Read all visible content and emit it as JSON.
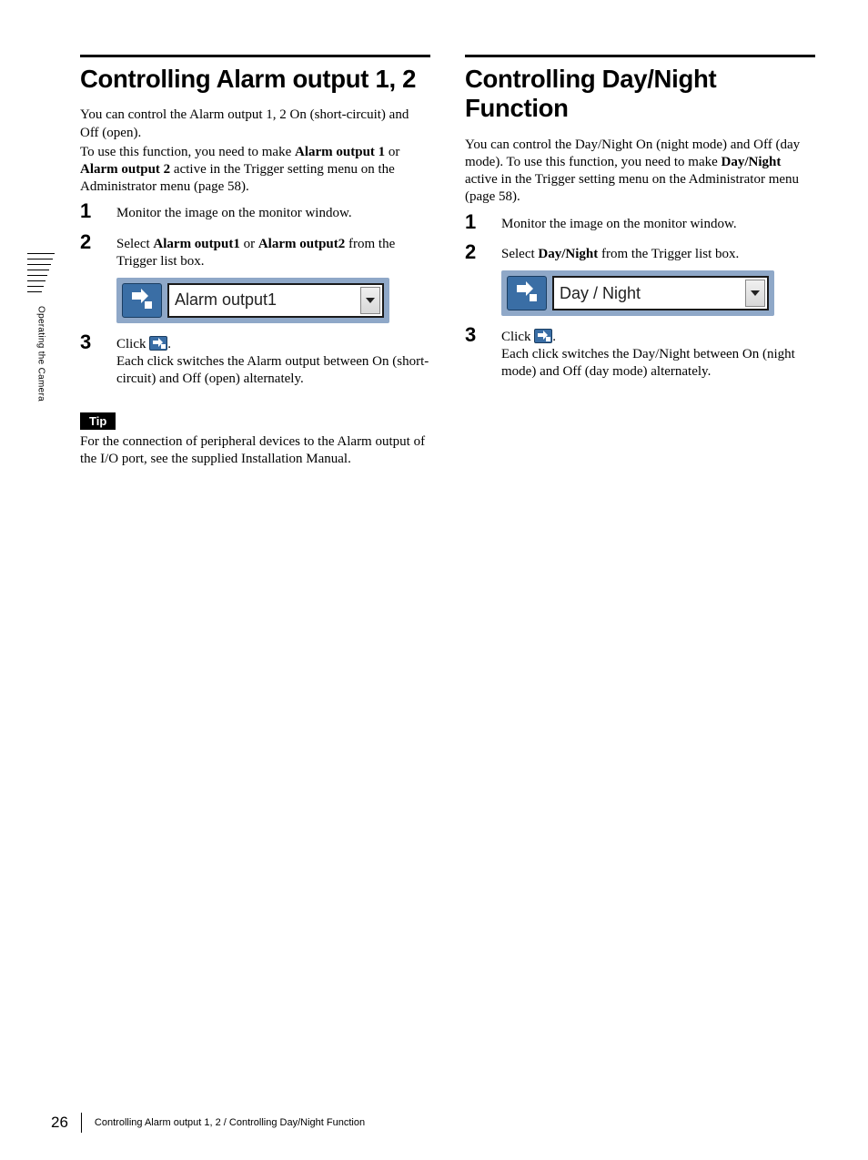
{
  "sidebar": {
    "section_label": "Operating the Camera"
  },
  "left": {
    "title": "Controlling Alarm output 1, 2",
    "intro_parts": [
      "You can control the Alarm output 1, 2 On (short-circuit) and Off (open).",
      "To use this function, you need to make ",
      "Alarm output 1",
      " or ",
      "Alarm output 2",
      " active in the Trigger setting menu on the Administrator menu (page 58)."
    ],
    "steps": {
      "s1": "Monitor the image on the monitor window.",
      "s2_pre": "Select ",
      "s2_b1": "Alarm output1",
      "s2_mid": " or ",
      "s2_b2": "Alarm output2",
      "s2_post": " from the Trigger list box.",
      "dropdown_value": "Alarm output1",
      "s3_pre": "Click ",
      "s3_post": ".",
      "s3_body": "Each click switches the Alarm output between On (short-circuit) and Off (open) alternately."
    },
    "tip_label": "Tip",
    "tip_body": "For the connection of peripheral devices to the Alarm output of the I/O port, see the supplied Installation Manual."
  },
  "right": {
    "title": "Controlling Day/Night Function",
    "intro_parts": [
      "You can control the Day/Night On (night mode) and Off (day mode). To use this function, you need to make ",
      "Day/Night",
      " active in the Trigger setting menu on the Administrator menu (page 58)."
    ],
    "steps": {
      "s1": "Monitor the image on the monitor window.",
      "s2_pre": "Select ",
      "s2_b1": "Day/Night",
      "s2_post": " from the Trigger list box.",
      "dropdown_value": "Day / Night",
      "s3_pre": "Click ",
      "s3_post": ".",
      "s3_body": "Each click switches the Day/Night between On (night mode) and Off (day mode) alternately."
    }
  },
  "footer": {
    "page_number": "26",
    "text": "Controlling Alarm output 1, 2 / Controlling Day/Night Function"
  }
}
